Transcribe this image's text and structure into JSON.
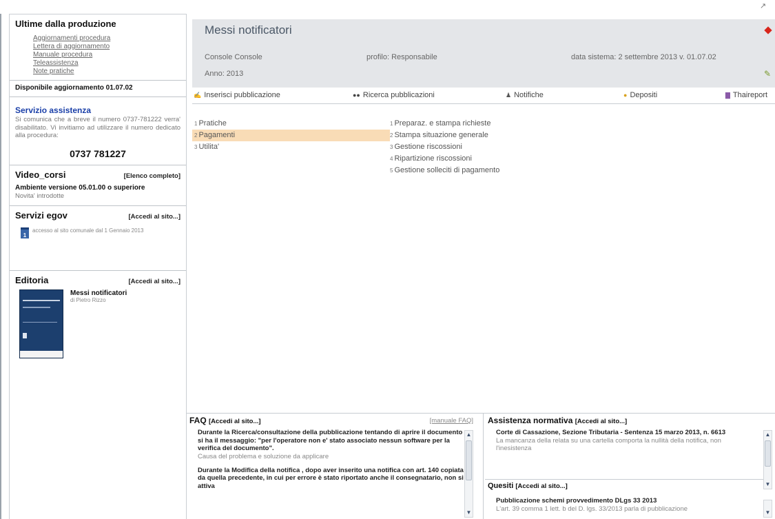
{
  "sidebar": {
    "news_title": "Ultime dalla produzione",
    "links": [
      "Aggiornamenti procedura",
      "Lettera di aggiornamento",
      "Manuale procedura",
      "Teleassistenza",
      "Note pratiche"
    ],
    "update_notice": "Disponibile aggiornamento 01.07.02",
    "assistance_title": "Servizio assistenza",
    "assistance_text": "Si comunica che a breve il numero 0737-781222 verra' disabilitato. Vi invitiamo ad utilizzare il numero dedicato alla procedura:",
    "assistance_phone": "0737 781227",
    "video_title": "Video_corsi",
    "video_link": "[Elenco completo]",
    "video_item": "Ambiente versione 05.01.00 o superiore",
    "video_note": "Novita' introdotte",
    "egov_title": "Servizi egov",
    "egov_link": "[Accedi al sito...]",
    "egov_day": "1",
    "egov_text": "accesso al sito comunale dal 1 Gennaio 2013",
    "editoria_title": "Editoria",
    "editoria_link": "[Accedi al sito...]",
    "book_title": "Messi notificatori",
    "book_author": "di Pietro Rizzo"
  },
  "header": {
    "title": "Messi notificatori",
    "console": "Console Console",
    "profilo": "profilo: Responsabile",
    "data_sistema": "data sistema: 2 settembre 2013   v. 01.07.02",
    "anno": "Anno: 2013"
  },
  "toolbar": {
    "items": [
      "Inserisci pubblicazione",
      "Ricerca pubblicazioni",
      "Notifiche",
      "Depositi",
      "Thaireport"
    ]
  },
  "menu": {
    "left": [
      {
        "num": "1",
        "label": "Pratiche"
      },
      {
        "num": "2",
        "label": "Pagamenti"
      },
      {
        "num": "3",
        "label": "Utilita'"
      }
    ],
    "right": [
      {
        "num": "1",
        "label": "Preparaz. e stampa richieste"
      },
      {
        "num": "2",
        "label": "Stampa situazione generale"
      },
      {
        "num": "3",
        "label": "Gestione riscossioni"
      },
      {
        "num": "4",
        "label": "Ripartizione riscossioni"
      },
      {
        "num": "5",
        "label": "Gestione solleciti di pagamento"
      }
    ]
  },
  "faq": {
    "title": "FAQ",
    "link": "[Accedi al sito...]",
    "manual_link": "[manuale FAQ]",
    "entries": [
      {
        "question": "Durante la Ricerca/consultazione della pubblicazione tentando di aprire il documento si ha il messaggio: \"per l'operatore non e' stato associato nessun software per la verifica del documento\".",
        "note": "Causa del problema e soluzione da applicare"
      },
      {
        "question": "Durante la Modifica della notifica , dopo aver inserito una notifica con art. 140 copiata da quella precedente, in cui per errore è stato riportato anche il consegnatario, non si attiva",
        "note": ""
      }
    ]
  },
  "assistenza": {
    "title": "Assistenza normativa",
    "link": "[Accedi al sito...]",
    "entry_title": "Corte di Cassazione, Sezione Tributaria - Sentenza 15 marzo 2013, n. 6613",
    "entry_note": "La mancanza della relata su una cartella comporta la nullità della notifica, non l'inesistenza",
    "quesiti_title": "Quesiti",
    "quesiti_link": "[Accedi al sito...]",
    "quesiti_entry_title": "Pubblicazione schemi provvedimento DLgs 33 2013",
    "quesiti_entry_note": "L'art. 39 comma 1 lett. b del D. lgs. 33/2013 parla di pubblicazione"
  }
}
